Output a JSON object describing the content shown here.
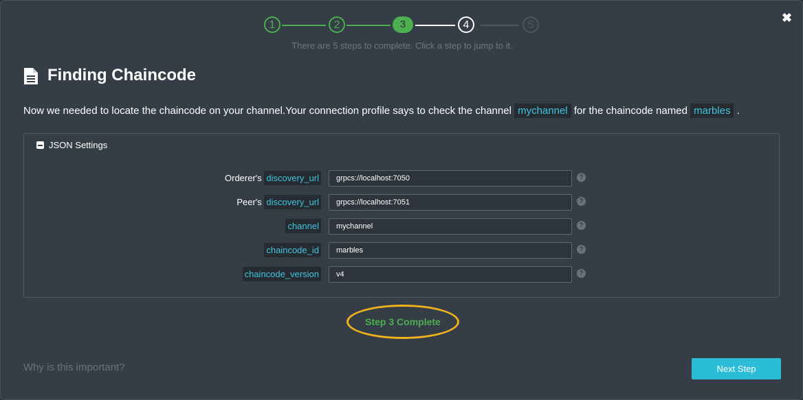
{
  "close_glyph": "✖",
  "stepper": {
    "steps": [
      {
        "label": "1",
        "state": "done"
      },
      {
        "label": "2",
        "state": "done"
      },
      {
        "label": "3",
        "state": "active"
      },
      {
        "label": "4",
        "state": "next"
      },
      {
        "label": "5",
        "state": "future"
      }
    ],
    "hint": "There are 5 steps to complete. Click a step to jump to it."
  },
  "header": {
    "icon": "document-icon",
    "title": "Finding Chaincode"
  },
  "intro": {
    "part1": "Now we needed to locate the chaincode on your channel.Your connection profile says to check the channel",
    "channel": "mychannel",
    "part2": "for the chaincode named",
    "chaincode": "marbles",
    "part3": "."
  },
  "settings": {
    "heading": "JSON Settings",
    "fields": [
      {
        "prefix": "Orderer's",
        "key": "discovery_url",
        "value": "grpcs://localhost:7050"
      },
      {
        "prefix": "Peer's",
        "key": "discovery_url",
        "value": "grpcs://localhost:7051"
      },
      {
        "prefix": "",
        "key": "channel",
        "value": "mychannel"
      },
      {
        "prefix": "",
        "key": "chaincode_id",
        "value": "marbles"
      },
      {
        "prefix": "",
        "key": "chaincode_version",
        "value": "v4"
      }
    ],
    "help_glyph": "?"
  },
  "status": "Step 3 Complete",
  "footer": {
    "why": "Why is this important?",
    "next_label": "Next Step"
  },
  "colors": {
    "accent_green": "#4caf50",
    "accent_cyan": "#2bbcd7",
    "highlight_ellipse": "#f0b21b",
    "background": "#353d46"
  }
}
